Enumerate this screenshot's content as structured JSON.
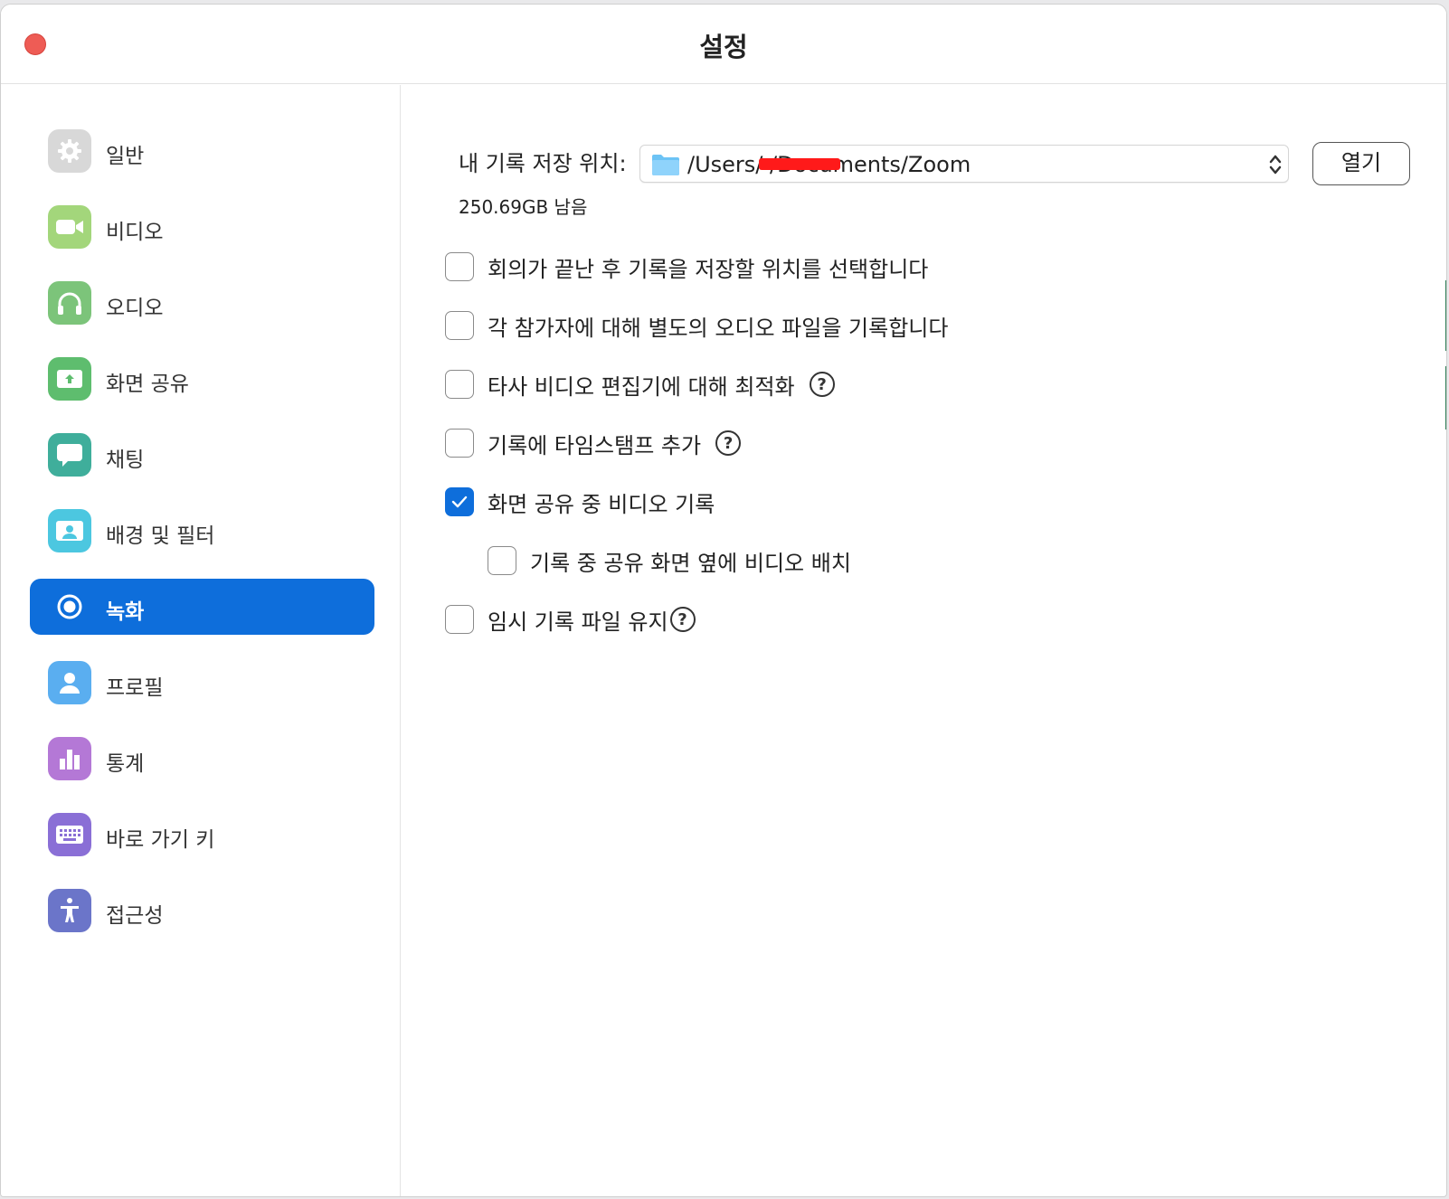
{
  "window": {
    "title": "설정"
  },
  "sidebar": {
    "items": [
      {
        "label": "일반",
        "icon": "gear-icon",
        "color": "#d8d8d8"
      },
      {
        "label": "비디오",
        "icon": "video-camera-icon",
        "color": "#a3d67b"
      },
      {
        "label": "오디오",
        "icon": "headphones-icon",
        "color": "#7cc47a"
      },
      {
        "label": "화면 공유",
        "icon": "share-screen-icon",
        "color": "#5ebd6e"
      },
      {
        "label": "채팅",
        "icon": "chat-bubble-icon",
        "color": "#3fae9b"
      },
      {
        "label": "배경 및 필터",
        "icon": "background-portrait-icon",
        "color": "#4cc7e0"
      },
      {
        "label": "녹화",
        "icon": "record-icon",
        "color": "#0e6edb",
        "active": true
      },
      {
        "label": "프로필",
        "icon": "user-icon",
        "color": "#5aaef0"
      },
      {
        "label": "통계",
        "icon": "bar-chart-icon",
        "color": "#b478d6"
      },
      {
        "label": "바로 가기 키",
        "icon": "keyboard-icon",
        "color": "#8a6fd6"
      },
      {
        "label": "접근성",
        "icon": "accessibility-icon",
        "color": "#6b75c9"
      }
    ]
  },
  "recording": {
    "location_label": "내 기록 저장 위치:",
    "location_path": "/Users/        /Documents/Zoom",
    "open_button": "열기",
    "free_space": "250.69GB 남음",
    "options": [
      {
        "label": "회의가 끝난 후 기록을 저장할 위치를 선택합니다",
        "checked": false,
        "help": false,
        "indent": false
      },
      {
        "label": "각 참가자에 대해 별도의 오디오 파일을 기록합니다",
        "checked": false,
        "help": false,
        "indent": false
      },
      {
        "label": "타사 비디오 편집기에 대해 최적화",
        "checked": false,
        "help": true,
        "indent": false
      },
      {
        "label": "기록에 타임스탬프 추가",
        "checked": false,
        "help": true,
        "indent": false
      },
      {
        "label": "화면 공유 중 비디오 기록",
        "checked": true,
        "help": false,
        "indent": false
      },
      {
        "label": "기록 중 공유 화면 옆에 비디오 배치",
        "checked": false,
        "help": false,
        "indent": true
      },
      {
        "label": "임시 기록 파일 유지",
        "checked": false,
        "help": true,
        "indent": false
      }
    ],
    "help_glyph": "?"
  },
  "colors": {
    "accent": "#0e6edb",
    "close": "#ee5c55"
  }
}
